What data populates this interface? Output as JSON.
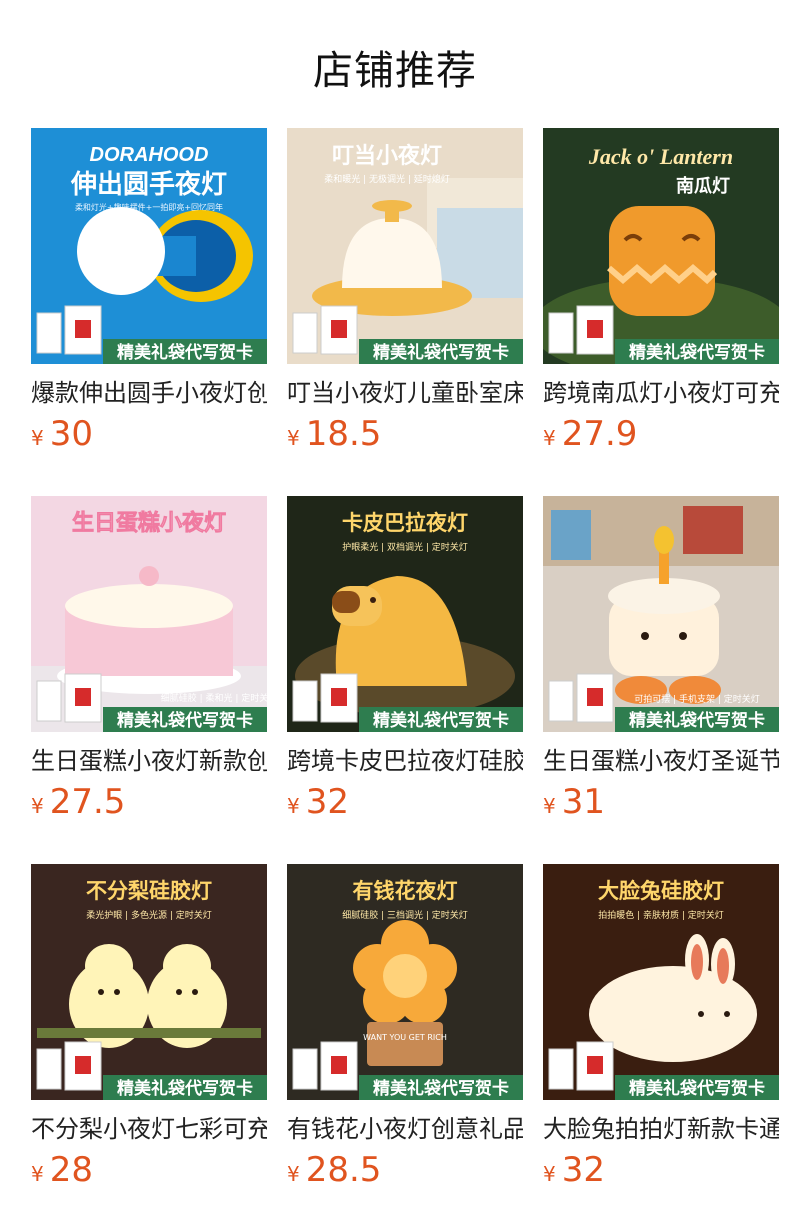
{
  "header": {
    "title": "店铺推荐"
  },
  "products": [
    {
      "name": "爆款伸出圆手小夜灯创意礼品",
      "currency": "¥",
      "price": "30",
      "image": {
        "brand": "DORAHOOD",
        "headline": "伸出圆手夜灯",
        "tagline": "柔和灯光+趣味摆件+一拍即亮+回忆同年",
        "banner": "精美礼袋代写贺卡",
        "icon": "hand-lamp-icon"
      }
    },
    {
      "name": "叮当小夜灯儿童卧室床头灯",
      "currency": "¥",
      "price": "18.5",
      "image": {
        "headline": "叮当小夜灯",
        "tagline": "柔和暖光 | 无极调光 | 延时熄灯",
        "banner": "精美礼袋代写贺卡",
        "icon": "bell-lamp-icon"
      }
    },
    {
      "name": "跨境南瓜灯小夜灯可充电",
      "currency": "¥",
      "price": "27.9",
      "image": {
        "headline": "Jack o' Lantern",
        "subhead": "南瓜灯",
        "banner": "精美礼袋代写贺卡",
        "icon": "pumpkin-lamp-icon"
      }
    },
    {
      "name": "生日蛋糕小夜灯新款创意",
      "currency": "¥",
      "price": "27.5",
      "image": {
        "headline": "生日蛋糕小夜灯",
        "tagline": "细腻硅胶 | 柔和光 | 定时关灯",
        "banner": "精美礼袋代写贺卡",
        "icon": "cake-lamp-icon"
      }
    },
    {
      "name": "跨境卡皮巴拉夜灯硅胶拍拍灯",
      "currency": "¥",
      "price": "32",
      "image": {
        "headline": "卡皮巴拉夜灯",
        "tagline": "护眼柔光 | 双档调光 | 定时关灯",
        "banner": "精美礼袋代写贺卡",
        "icon": "capybara-lamp-icon"
      }
    },
    {
      "name": "生日蛋糕小夜灯圣诞节礼物",
      "currency": "¥",
      "price": "31",
      "image": {
        "tagline": "可拍可摆 | 手机支架 | 定时关灯",
        "banner": "精美礼袋代写贺卡",
        "icon": "candle-cake-lamp-icon"
      }
    },
    {
      "name": "不分梨小夜灯七彩可充电",
      "currency": "¥",
      "price": "28",
      "image": {
        "headline": "不分梨硅胶灯",
        "tagline": "柔光护眼 | 多色光源 | 定时关灯",
        "banner": "精美礼袋代写贺卡",
        "icon": "pear-lamp-icon"
      }
    },
    {
      "name": "有钱花小夜灯创意礼品摆件",
      "currency": "¥",
      "price": "28.5",
      "image": {
        "headline": "有钱花夜灯",
        "tagline": "细腻硅胶 | 三档调光 | 定时关灯",
        "pot_text": "WANT YOU GET RICH",
        "banner": "精美礼袋代写贺卡",
        "icon": "flower-lamp-icon"
      }
    },
    {
      "name": "大脸兔拍拍灯新款卡通夜灯",
      "currency": "¥",
      "price": "32",
      "image": {
        "headline": "大脸兔硅胶灯",
        "tagline": "拍拍暖色 | 亲肤材质 | 定时关灯",
        "banner": "精美礼袋代写贺卡",
        "icon": "rabbit-lamp-icon"
      }
    }
  ],
  "colors": {
    "price": "#e0541f",
    "banner": "#2e7d4f",
    "title": "#111111"
  }
}
